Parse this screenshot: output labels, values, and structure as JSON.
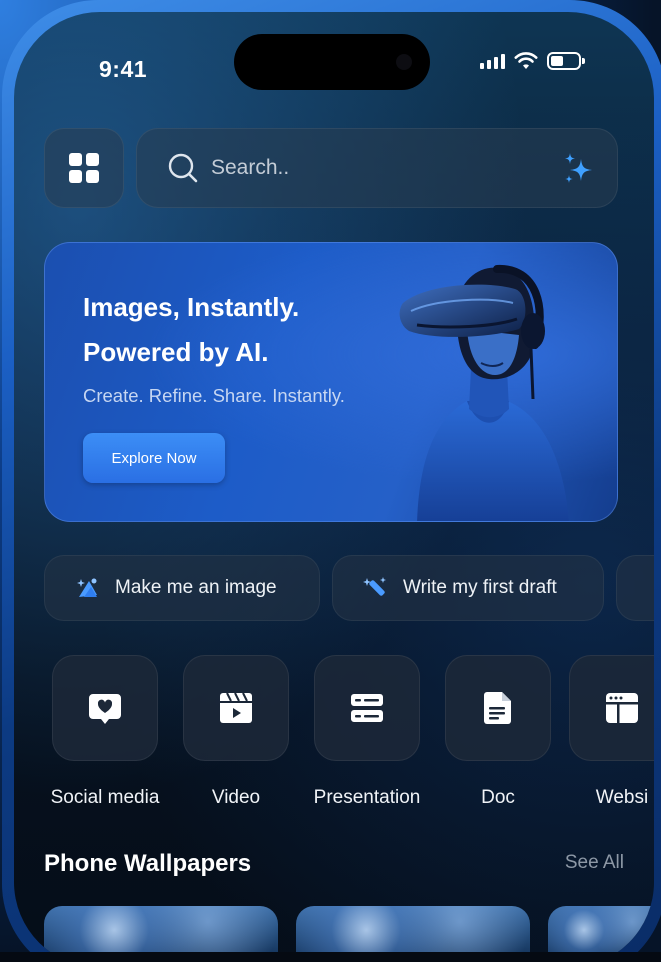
{
  "status": {
    "time": "9:41"
  },
  "search": {
    "placeholder": "Search.."
  },
  "hero": {
    "title_line1": "Images, Instantly.",
    "title_line2": "Powered by AI.",
    "subtitle": "Create. Refine. Share. Instantly.",
    "cta_label": "Explore Now"
  },
  "chips": [
    {
      "label": "Make me an image",
      "icon": "image-magic-icon"
    },
    {
      "label": "Write my first draft",
      "icon": "pen-magic-icon"
    }
  ],
  "categories": [
    {
      "label": "Social media",
      "icon": "heart-chat-icon"
    },
    {
      "label": "Video",
      "icon": "video-clapper-icon"
    },
    {
      "label": "Presentation",
      "icon": "presentation-icon"
    },
    {
      "label": "Doc",
      "icon": "document-icon"
    },
    {
      "label": "Websi",
      "icon": "website-icon"
    }
  ],
  "wallpapers": {
    "title": "Phone Wallpapers",
    "see_all": "See All"
  },
  "colors": {
    "accent": "#2f7ef0",
    "sparkle": "#3fa0ff",
    "muted_text": "#8d98a6"
  }
}
